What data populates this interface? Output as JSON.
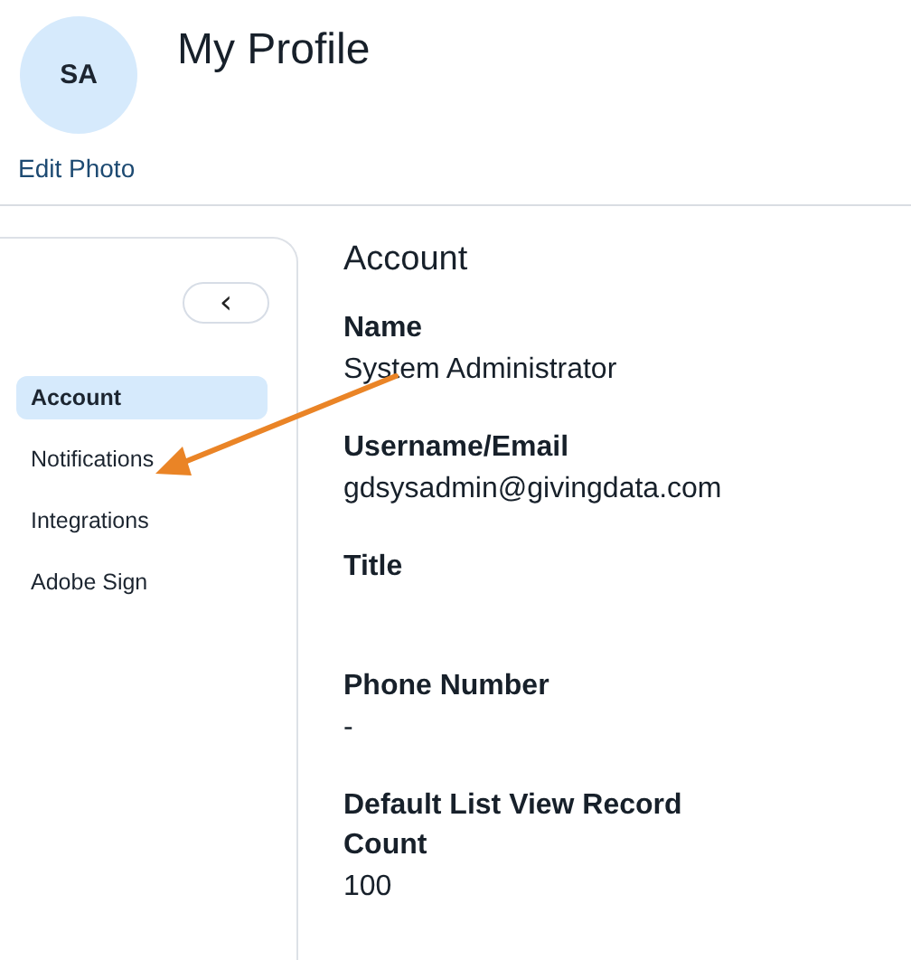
{
  "header": {
    "avatar_initials": "SA",
    "title": "My Profile",
    "edit_photo": "Edit Photo"
  },
  "sidebar": {
    "collapse_button": "‹",
    "items": [
      {
        "label": "Account",
        "selected": true
      },
      {
        "label": "Notifications",
        "selected": false
      },
      {
        "label": "Integrations",
        "selected": false
      },
      {
        "label": "Adobe Sign",
        "selected": false
      }
    ]
  },
  "content": {
    "heading": "Account",
    "fields": [
      {
        "label": "Name",
        "value": "System Administrator"
      },
      {
        "label": "Username/Email",
        "value": "gdsysadmin@givingdata.com"
      },
      {
        "label": "Title"
      },
      {
        "label": "Phone Number",
        "value": "-"
      },
      {
        "label": "Default List View Record Count",
        "value": "100"
      }
    ]
  },
  "annotations": [
    {
      "kind": "arrow"
    }
  ]
}
